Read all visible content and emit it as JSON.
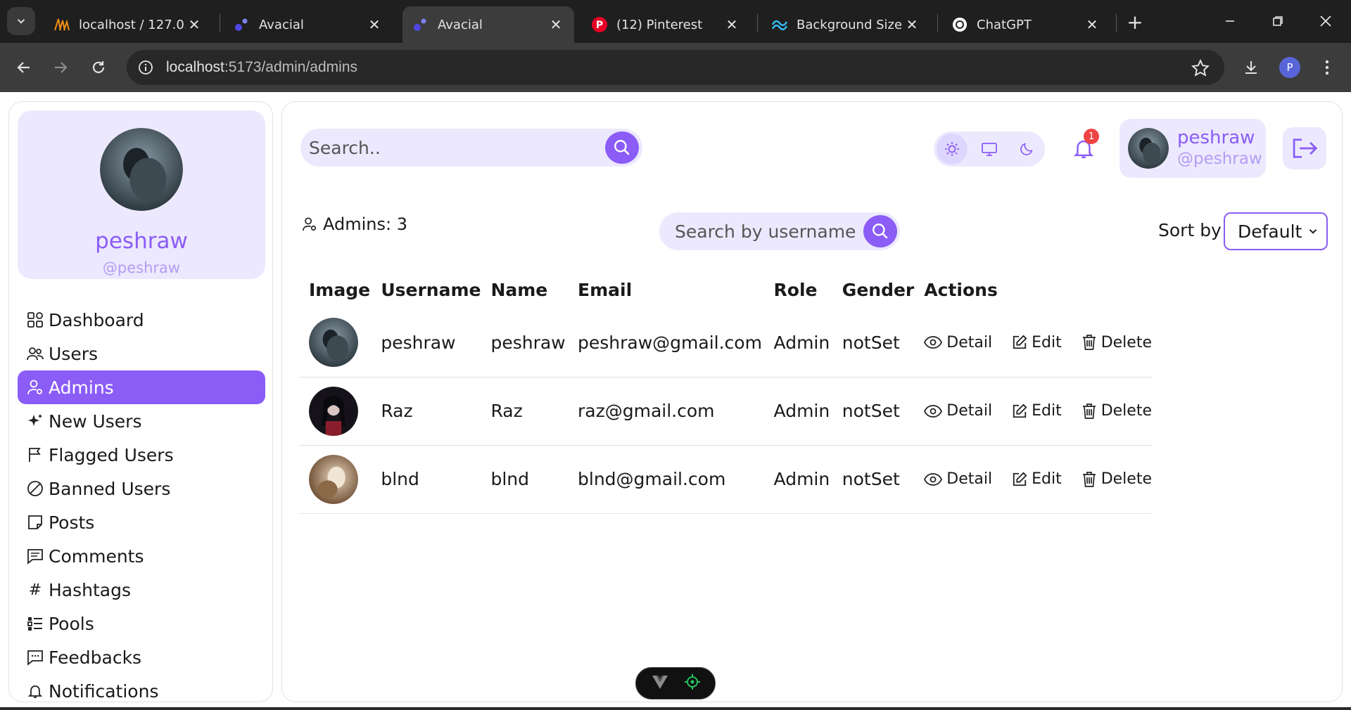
{
  "browser": {
    "tabs": [
      {
        "title": "localhost / 127.0.0.",
        "active": false
      },
      {
        "title": "Avacial",
        "active": false
      },
      {
        "title": "Avacial",
        "active": true
      },
      {
        "title": "(12) Pinterest",
        "active": false
      },
      {
        "title": "Background Size -",
        "active": false
      },
      {
        "title": "ChatGPT",
        "active": false
      }
    ],
    "url_host": "localhost",
    "url_path": ":5173/admin/admins",
    "profile_initial": "P"
  },
  "sidebar": {
    "profile": {
      "name": "peshraw",
      "handle": "@peshraw"
    },
    "items": [
      {
        "label": "Dashboard",
        "icon": "dashboard-icon"
      },
      {
        "label": "Users",
        "icon": "users-icon"
      },
      {
        "label": "Admins",
        "icon": "admins-icon",
        "active": true
      },
      {
        "label": "New Users",
        "icon": "sparkle-icon"
      },
      {
        "label": "Flagged Users",
        "icon": "flag-icon"
      },
      {
        "label": "Banned Users",
        "icon": "ban-icon"
      },
      {
        "label": "Posts",
        "icon": "posts-icon"
      },
      {
        "label": "Comments",
        "icon": "comments-icon"
      },
      {
        "label": "Hashtags",
        "icon": "hashtag-icon"
      },
      {
        "label": "Pools",
        "icon": "pools-icon"
      },
      {
        "label": "Feedbacks",
        "icon": "feedback-icon"
      },
      {
        "label": "Notifications",
        "icon": "bell-icon"
      }
    ]
  },
  "header": {
    "search_placeholder": "Search..",
    "notification_count": "1",
    "user": {
      "name": "peshraw",
      "handle": "@peshraw"
    }
  },
  "content": {
    "admins_count_label": "Admins: 3",
    "username_search_placeholder": "Search by username",
    "sort_label": "Sort by",
    "sort_value": "Default",
    "columns": [
      "Image",
      "Username",
      "Name",
      "Email",
      "Role",
      "Gender",
      "Actions"
    ],
    "action_labels": {
      "detail": "Detail",
      "edit": "Edit",
      "delete": "Delete"
    },
    "rows": [
      {
        "username": "peshraw",
        "name": "peshraw",
        "email": "peshraw@gmail.com",
        "role": "Admin",
        "gender": "notSet"
      },
      {
        "username": "Raz",
        "name": "Raz",
        "email": "raz@gmail.com",
        "role": "Admin",
        "gender": "notSet"
      },
      {
        "username": "blnd",
        "name": "blnd",
        "email": "blnd@gmail.com",
        "role": "Admin",
        "gender": "notSet"
      }
    ]
  },
  "colors": {
    "accent": "#8b5cf6",
    "accent_light": "#ece9fe",
    "role_link": "#3b82f6",
    "badge": "#ef4444"
  }
}
